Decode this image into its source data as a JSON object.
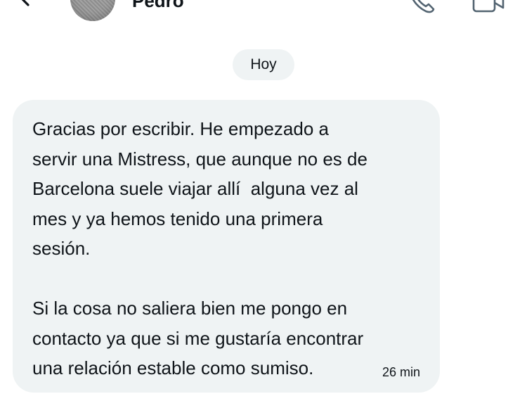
{
  "header": {
    "contact_name": "Pedro",
    "icons": {
      "back": "arrow-left-icon",
      "call": "phone-icon",
      "video": "video-camera-icon"
    }
  },
  "conversation": {
    "date_separator": "Hoy",
    "messages": [
      {
        "direction": "incoming",
        "text_lines": [
          "Gracias por escribir. He empezado a",
          "servir una Mistress, que aunque no es de",
          "Barcelona suele viajar allí  alguna vez al",
          "mes y ya hemos tenido una primera",
          "sesión.",
          "",
          "Si la cosa no saliera bien me pongo en",
          "contacto ya que si me gustaría encontrar",
          "una relación estable como sumiso."
        ],
        "time": "26 min"
      }
    ]
  },
  "colors": {
    "bubble_background": "#eff3f4",
    "text": "#0f1419",
    "background": "#ffffff"
  }
}
